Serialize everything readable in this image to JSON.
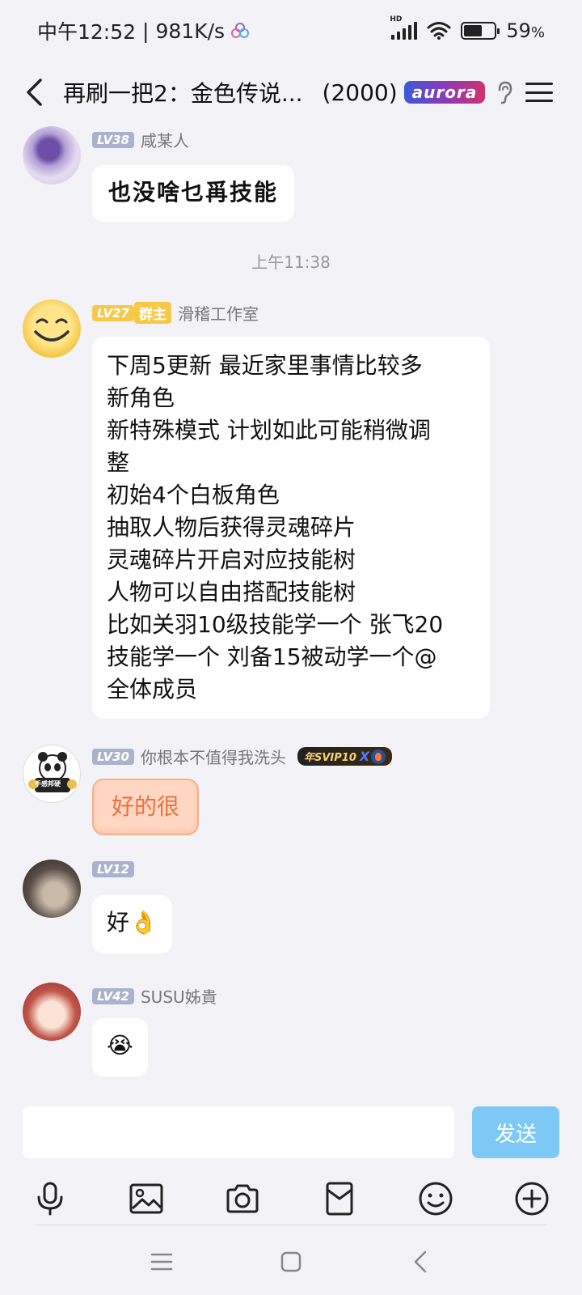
{
  "status_bar": {
    "time": "中午12:52",
    "separator": "|",
    "network_speed": "981K/s",
    "hd_label": "HD",
    "battery_percent": "59",
    "battery_percent_symbol": "%",
    "battery_level": 0.59
  },
  "header": {
    "title": "再刷一把2：金色传说...",
    "member_count": "(2000)",
    "badge_text": "aurora"
  },
  "messages": [
    {
      "level": "LV38",
      "sender": "咸某人",
      "text": "也没啥乜爯技能"
    },
    {
      "timestamp": "上午11:38"
    },
    {
      "level": "LV27",
      "role": "群主",
      "sender": "滑稽工作室",
      "lines": [
        "下周5更新 最近家里事情比较多",
        "新角色",
        "新特殊模式 计划如此可能稍微调",
        "整",
        "初始4个白板角色",
        "抽取人物后获得灵魂碎片",
        "灵魂碎片开启对应技能树",
        "人物可以自由搭配技能树",
        "比如关羽10级技能学一个 张飞20",
        "技能学一个 刘备15被动学一个@",
        "全体成员"
      ]
    },
    {
      "level": "LV30",
      "sender": "你根本不值得我洗头",
      "svip_badge": "年SVIP10",
      "avatar_caption": "手感邦硬",
      "text": "好的很"
    },
    {
      "level": "LV12",
      "sender": "",
      "text": "好👌"
    },
    {
      "level": "LV42",
      "sender": "SUSU姊貴",
      "text": "😭"
    }
  ],
  "input": {
    "placeholder": "",
    "send_label": "发送"
  },
  "toolbar_icons": [
    "microphone-icon",
    "image-icon",
    "camera-icon",
    "red-packet-icon",
    "emoji-icon",
    "plus-icon"
  ],
  "navbar_icons": [
    "recent-apps-icon",
    "home-icon",
    "back-icon"
  ],
  "colors": {
    "background": "#f2f2f7",
    "send_button": "#7ec8f5",
    "owner_tag": "#f7c948",
    "level_badge": "#aab3cc",
    "orange_bubble": "#ffd7c2",
    "orange_text": "#e9713f"
  }
}
